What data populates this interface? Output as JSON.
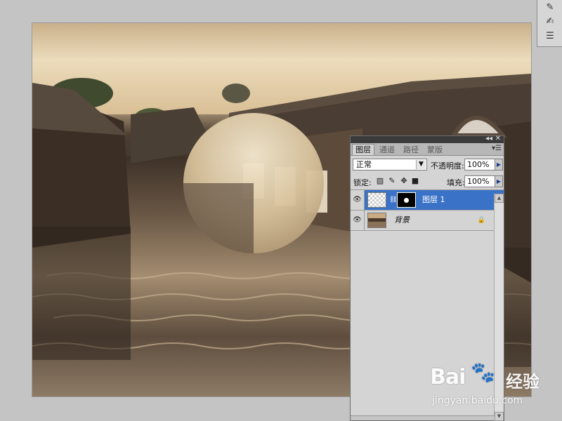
{
  "toolstrip": {
    "tools": [
      "stamp-tool-icon",
      "history-brush-icon",
      "settings-sliders-icon"
    ]
  },
  "panel": {
    "tabs": [
      {
        "label": "图层",
        "active": true
      },
      {
        "label": "通道",
        "active": false
      },
      {
        "label": "路径",
        "active": false
      },
      {
        "label": "蒙版",
        "active": false
      }
    ],
    "blend_mode": "正常",
    "opacity_label": "不透明度:",
    "opacity_value": "100%",
    "lock_label": "锁定:",
    "fill_label": "填充:",
    "fill_value": "100%",
    "layers": [
      {
        "name": "图层 1",
        "selected": true,
        "has_mask": true
      },
      {
        "name": "背景",
        "selected": false,
        "locked": true
      }
    ]
  },
  "watermark": {
    "logo_text": "Bai",
    "logo_text2": "经验",
    "url": "jingyan.baidu.com"
  },
  "colors": {
    "selection": "#3a72c7",
    "panel_bg": "#d4d4d4",
    "workspace_bg": "#c4c4c4"
  }
}
